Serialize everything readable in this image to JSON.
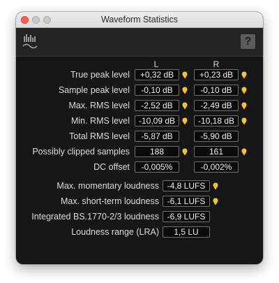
{
  "window": {
    "title": "Waveform Statistics"
  },
  "toolbar": {
    "help_label": "?"
  },
  "columns": {
    "left": "L",
    "right": "R"
  },
  "stereo_stats": [
    {
      "label": "True peak level",
      "left": "+0,32 dB",
      "right": "+0,23 dB",
      "left_marker": true,
      "right_marker": true
    },
    {
      "label": "Sample peak level",
      "left": "-0,10 dB",
      "right": "-0,10 dB",
      "left_marker": true,
      "right_marker": true
    },
    {
      "label": "Max. RMS level",
      "left": "-2,52 dB",
      "right": "-2,49 dB",
      "left_marker": true,
      "right_marker": true
    },
    {
      "label": "Min. RMS level",
      "left": "-10,09 dB",
      "right": "-10,18 dB",
      "left_marker": true,
      "right_marker": true
    },
    {
      "label": "Total RMS level",
      "left": "-5,87 dB",
      "right": "-5,90 dB",
      "left_marker": false,
      "right_marker": false
    },
    {
      "label": "Possibly clipped samples",
      "left": "188",
      "right": "161",
      "left_marker": true,
      "right_marker": true
    },
    {
      "label": "DC offset",
      "left": "-0,005%",
      "right": "-0,002%",
      "left_marker": false,
      "right_marker": false
    }
  ],
  "loudness_stats": [
    {
      "label": "Max. momentary loudness",
      "value": "-4,8 LUFS",
      "marker": true
    },
    {
      "label": "Max. short-term loudness",
      "value": "-6,1 LUFS",
      "marker": true
    },
    {
      "label": "Integrated BS.1770-2/3 loudness",
      "value": "-6,9 LUFS",
      "marker": false
    },
    {
      "label": "Loudness range (LRA)",
      "value": "1,5 LU",
      "marker": false
    }
  ],
  "colors": {
    "marker": "#f2c23a",
    "background": "#161616",
    "value_border": "#6e6e6e",
    "text": "#dcdcdc"
  }
}
